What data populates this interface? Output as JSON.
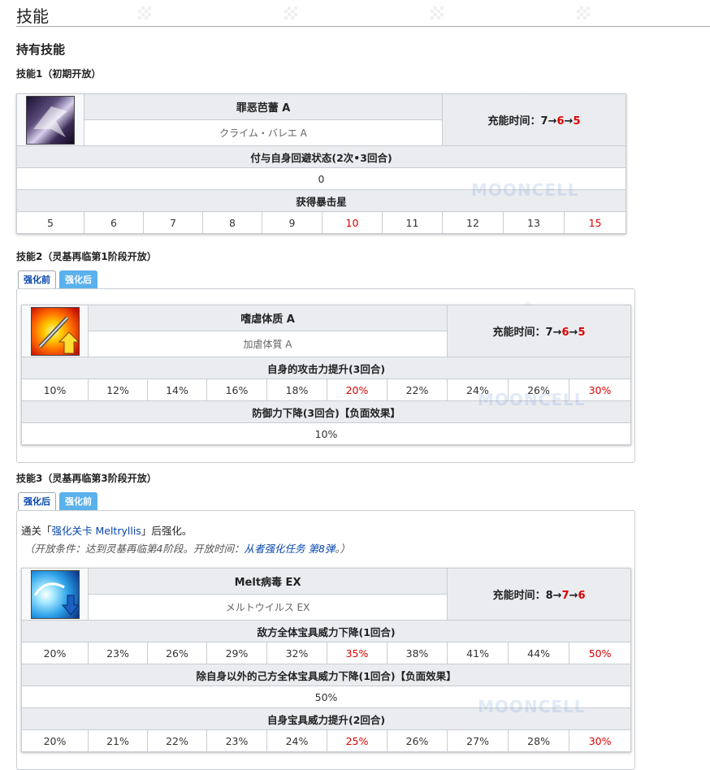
{
  "page": {
    "title": "技能",
    "section_title": "持有技能"
  },
  "skills": [
    {
      "heading": "技能1（初期开放）",
      "name": "罪恶芭蕾 A",
      "name_jp": "クライム・バレエ A",
      "cooldown_label": "充能时间：",
      "cooldown": [
        "7",
        "6",
        "5"
      ],
      "effects": [
        {
          "label": "付与自身回避状态(2次•3回合)",
          "values": [
            "0"
          ]
        },
        {
          "label": "获得暴击星",
          "values": [
            "5",
            "6",
            "7",
            "8",
            "9",
            "10",
            "11",
            "12",
            "13",
            "15"
          ]
        }
      ],
      "icon": "dancer-icon"
    },
    {
      "heading": "技能2（灵基再临第1阶段开放）",
      "tabs": [
        "强化前",
        "强化后"
      ],
      "name": "嗜虐体质 A",
      "name_jp": "加虐体質 A",
      "cooldown_label": "充能时间：",
      "cooldown": [
        "7",
        "6",
        "5"
      ],
      "effects": [
        {
          "label": "自身的攻击力提升(3回合)",
          "values": [
            "10%",
            "12%",
            "14%",
            "16%",
            "18%",
            "20%",
            "22%",
            "24%",
            "26%",
            "30%"
          ]
        },
        {
          "label": "防御力下降(3回合)【负面效果】",
          "values": [
            "10%"
          ]
        }
      ],
      "icon": "sword-up-icon"
    },
    {
      "heading": "技能3（灵基再临第3阶段开放）",
      "tabs": [
        "强化后",
        "强化前"
      ],
      "condition_prefix": "通关「",
      "condition_link": "强化关卡 Meltryllis",
      "condition_suffix": "」后强化。",
      "note_prefix": "（开放条件：达到灵基再临第4阶段。开放时间：",
      "note_link": "从者强化任务 第8弹",
      "note_suffix": "。）",
      "name": "Melt病毒 EX",
      "name_jp": "メルトウイルス EX",
      "cooldown_label": "充能时间：",
      "cooldown": [
        "8",
        "7",
        "6"
      ],
      "effects": [
        {
          "label": "敌方全体宝具威力下降(1回合)",
          "values": [
            "20%",
            "23%",
            "26%",
            "29%",
            "32%",
            "35%",
            "38%",
            "41%",
            "44%",
            "50%"
          ]
        },
        {
          "label": "除自身以外的己方全体宝具威力下降(1回合)【负面效果】",
          "values": [
            "50%"
          ]
        },
        {
          "label": "自身宝具威力提升(2回合)",
          "values": [
            "20%",
            "21%",
            "22%",
            "23%",
            "24%",
            "25%",
            "26%",
            "27%",
            "28%",
            "30%"
          ]
        }
      ],
      "icon": "wave-down-icon"
    }
  ],
  "arrow": "→",
  "watermark": "MOONCELL",
  "colors": {
    "accent_red": "#dd0000",
    "link": "#0645ad",
    "tab_inactive": "#5bb1eb",
    "header_bg": "#eaecf0"
  }
}
